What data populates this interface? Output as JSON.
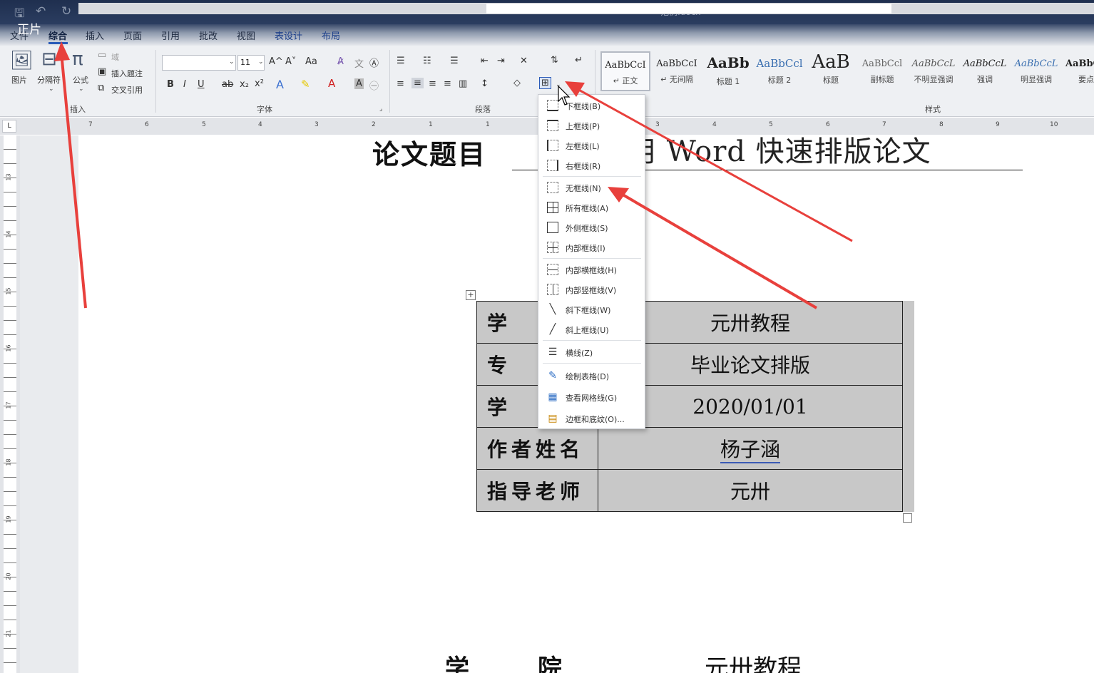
{
  "titlebar": {
    "doc_title": "范例.docx",
    "chevron": "⌄",
    "qat_save": "🖫",
    "qat_undo": "↶",
    "qat_redo": "↻",
    "qat_more": "⌄"
  },
  "overlay_label": "正片",
  "menu": {
    "file": "文件",
    "general": "综合",
    "insert": "插入",
    "page": "页面",
    "references": "引用",
    "review": "批改",
    "view": "视图",
    "table_design": "表设计",
    "layout": "布局"
  },
  "ribbon": {
    "insert_group": {
      "title": "插入",
      "picture": "图片",
      "separator": "分隔符",
      "formula": "公式",
      "field": "域",
      "insert_caption": "插入题注",
      "cross_ref": "交叉引用"
    },
    "font_group": {
      "title": "字体",
      "font_name": "",
      "font_size": "11",
      "bold": "B",
      "italic": "I",
      "underline": "U",
      "strike": "ab",
      "subscript": "x₂",
      "superscript": "x²",
      "grow": "A^",
      "shrink": "A˅",
      "case": "Aa"
    },
    "paragraph_group": {
      "title": "段落"
    },
    "styles_group": {
      "title": "样式",
      "items": [
        {
          "sample": "AaBbCcI",
          "name": "↵ 正文"
        },
        {
          "sample": "AaBbCcI",
          "name": "↵ 无间隔"
        },
        {
          "sample": "AaBb",
          "name": "标题 1"
        },
        {
          "sample": "AaBbCcl",
          "name": "标题 2"
        },
        {
          "sample": "AaB",
          "name": "标题"
        },
        {
          "sample": "AaBbCcl",
          "name": "副标题"
        },
        {
          "sample": "AaBbCcL",
          "name": "不明显强调"
        },
        {
          "sample": "AaBbCcL",
          "name": "强调"
        },
        {
          "sample": "AaBbCcL",
          "name": "明显强调"
        },
        {
          "sample": "AaBbC",
          "name": "要点"
        }
      ]
    }
  },
  "ruler": {
    "corner": "L",
    "numbers": [
      "7",
      "6",
      "5",
      "4",
      "3",
      "2",
      "1",
      "1",
      "3",
      "4",
      "5",
      "6",
      "7",
      "8",
      "9",
      "10"
    ]
  },
  "vruler": {
    "numbers": [
      "13",
      "14",
      "15",
      "16",
      "17",
      "18",
      "19",
      "20",
      "21"
    ]
  },
  "document": {
    "heading_left": "论文题目",
    "heading_right": "用 Word 快速排版论文",
    "table": [
      {
        "label": "学",
        "value": "元卅教程"
      },
      {
        "label": "专",
        "value": "毕业论文排版"
      },
      {
        "label": "学",
        "value": "2020/01/01"
      },
      {
        "label": "作者姓名",
        "value": "杨子涵"
      },
      {
        "label": "指导老师",
        "value": "元卅"
      }
    ],
    "bottom_left": "学",
    "bottom_mid": "院",
    "bottom_right": "元卅教程"
  },
  "border_menu": {
    "items": [
      {
        "label": "下框线(B)",
        "icon": "bottom-border-icon"
      },
      {
        "label": "上框线(P)",
        "icon": "top-border-icon"
      },
      {
        "label": "左框线(L)",
        "icon": "left-border-icon"
      },
      {
        "label": "右框线(R)",
        "icon": "right-border-icon"
      },
      {
        "label": "无框线(N)",
        "icon": "no-border-icon"
      },
      {
        "label": "所有框线(A)",
        "icon": "all-borders-icon"
      },
      {
        "label": "外侧框线(S)",
        "icon": "outside-borders-icon"
      },
      {
        "label": "内部框线(I)",
        "icon": "inside-borders-icon"
      },
      {
        "label": "内部横框线(H)",
        "icon": "inside-horizontal-border-icon"
      },
      {
        "label": "内部竖框线(V)",
        "icon": "inside-vertical-border-icon"
      },
      {
        "label": "斜下框线(W)",
        "icon": "diagonal-down-border-icon"
      },
      {
        "label": "斜上框线(U)",
        "icon": "diagonal-up-border-icon"
      },
      {
        "label": "横线(Z)",
        "icon": "horizontal-line-icon"
      },
      {
        "label": "绘制表格(D)",
        "icon": "draw-table-icon"
      },
      {
        "label": "查看网格线(G)",
        "icon": "view-gridlines-icon"
      },
      {
        "label": "边框和底纹(O)...",
        "icon": "borders-shading-icon"
      }
    ]
  },
  "colors": {
    "arrow": "#e8403c",
    "table_fill": "#c8c8c8",
    "titlebar": "#1f2f4f"
  }
}
